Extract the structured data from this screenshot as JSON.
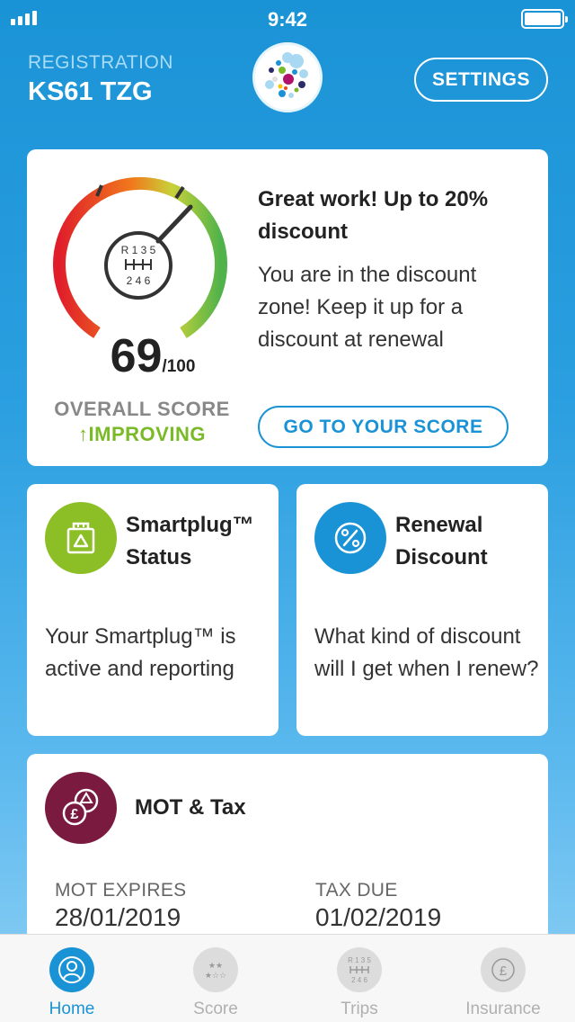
{
  "status_bar": {
    "time": "9:42",
    "icons": [
      "signal-icon",
      "battery-icon"
    ]
  },
  "header": {
    "registration_label": "REGISTRATION",
    "registration_value": "KS61 TZG",
    "settings_label": "SETTINGS",
    "logo_icon": "dots-logo"
  },
  "score_card": {
    "score": "69",
    "score_max": "/100",
    "score_fraction": 0.69,
    "gauge_shift_labels": {
      "top": "R 1 3 5",
      "bottom": "2 4 6"
    },
    "overall_label": "OVERALL SCORE",
    "trend_arrow": "↑",
    "trend_label": "IMPROVING",
    "title": "Great work! Up to 20% discount",
    "text": "You are in the discount zone! Keep it up for a discount at renewal",
    "button_label": "GO TO YOUR SCORE"
  },
  "smartplug_card": {
    "icon": "smartplug-icon",
    "title": "Smartplug™ Status",
    "text": "Your Smartplug™ is active and reporting",
    "accent": "#8cbf26"
  },
  "renewal_card": {
    "icon": "percent-icon",
    "title": "Renewal Discount",
    "text": "What kind of discount will I get when I renew?",
    "accent": "#1a93d6"
  },
  "mot_card": {
    "icon": "mot-tax-icon",
    "title": "MOT & Tax",
    "accent": "#7a1a3e",
    "mot_label": "MOT EXPIRES",
    "mot_value": "28/01/2019",
    "tax_label": "TAX DUE",
    "tax_value": "01/02/2019"
  },
  "tabbar": {
    "tabs": [
      {
        "label": "Home",
        "icon": "home-person-icon",
        "active": true
      },
      {
        "label": "Score",
        "icon": "stars-icon",
        "active": false
      },
      {
        "label": "Trips",
        "icon": "gearshift-icon",
        "active": false,
        "icon_top": "R 1 3 5",
        "icon_bottom": "2 4 6"
      },
      {
        "label": "Insurance",
        "icon": "pound-icon",
        "active": false
      }
    ]
  },
  "colors": {
    "primary": "#1a93d6",
    "improving": "#7ab928"
  }
}
